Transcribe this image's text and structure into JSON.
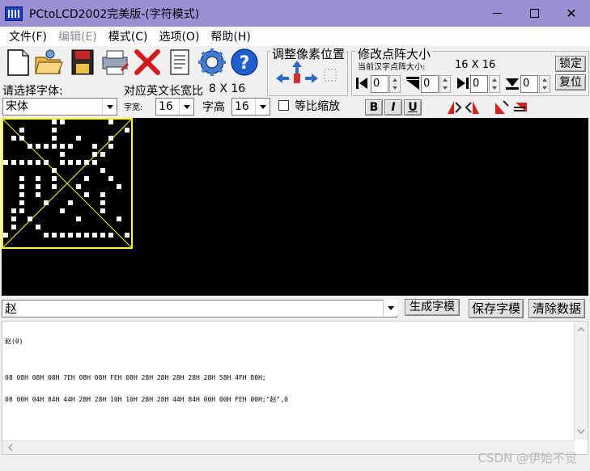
{
  "window": {
    "title": "PCtoLCD2002完美版-(字符模式)",
    "minimize": "—",
    "maximize": "□",
    "close": "✕"
  },
  "menu": [
    {
      "label": "文件(F)",
      "enabled": true
    },
    {
      "label": "编辑(E)",
      "enabled": false
    },
    {
      "label": "模式(C)",
      "enabled": true
    },
    {
      "label": "选项(O)",
      "enabled": true
    },
    {
      "label": "帮助(H)",
      "enabled": true
    }
  ],
  "toolbar_icons": [
    "new-file-icon",
    "open-folder-icon",
    "save-floppy-icon",
    "print-icon",
    "delete-x-icon",
    "notepad-icon",
    "gear-icon",
    "help-question-icon"
  ],
  "font_panel": {
    "label": "请选择字体:",
    "font_value": "宋体",
    "ratio_label": "对应英文长宽比",
    "ratio_value": "8 X 16",
    "width_label": "字宽:",
    "width_value": "16",
    "height_label": "字高",
    "height_value": "16",
    "scale_label": "等比缩放",
    "bold": "B",
    "italic": "I",
    "underline": "U"
  },
  "pixel_adjust": {
    "title": "调整像素位置"
  },
  "dot_size": {
    "title": "修改点阵大小",
    "current_label": "当前汉字点阵大小:",
    "current_value": "16 X 16",
    "lock_button": "锁定",
    "reset_button": "复位",
    "spins": [
      "0",
      "0",
      "0",
      "0"
    ]
  },
  "input": {
    "char_value": "赵"
  },
  "buttons": {
    "generate": "生成字模",
    "save": "保存字模",
    "clear": "清除数据"
  },
  "output": {
    "lines": [
      "赵(0)",
      "",
      "08 08H 08H 08H 7EH 08H 08H FEH 08H 28H 28H 28H 28H 28H 58H 4FH 80H;",
      "08 00H 04H 84H 44H 28H 28H 10H 10H 28H 28H 44H 84H 00H 00H FEH 00H;\"赵\",0"
    ]
  },
  "watermark": "CSDN @伊始不觉",
  "colors": {
    "titlebar": "#9c8fd4",
    "canvas_bg": "#000000",
    "pixel_on": "#ffffff",
    "frame": "#ffff00"
  },
  "glyph_bitmap": [
    "......**.....*..",
    "..*...*........*",
    ".**...*..*...*..",
    "...******..*.*..",
    ".......*...**...",
    "******.*****....",
    "......*.....*...",
    "..*.*.*...*..*..",
    "..*.*.*..*....*.",
    "..*.*.....*.*...",
    "..*..*..*...*...",
    ".**....*....*...",
    ".*.*.....*....*.",
    ".*..*...........",
    "*....*********.*",
    "................"
  ]
}
